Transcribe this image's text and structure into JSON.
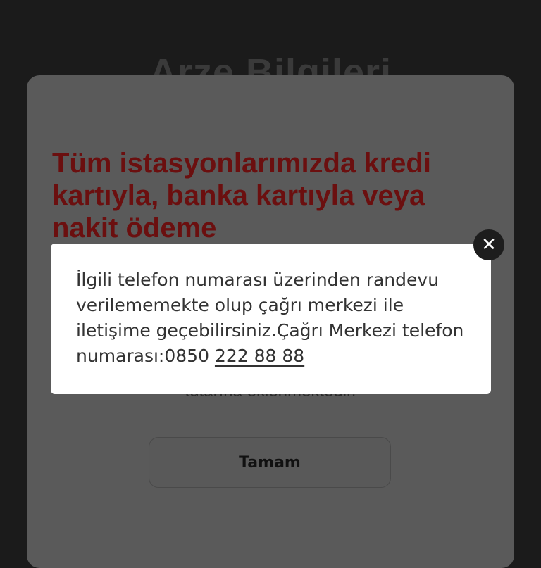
{
  "background": {
    "title": "Arze Bilgileri"
  },
  "modal": {
    "headline": "Tüm istasyonlarımızda kredi kartıyla, banka kartıyla veya nakit ödeme",
    "hidden_text": "tutarına eklenmektedir.",
    "ok_label": "Tamam"
  },
  "popup": {
    "text": "İlgili telefon numarası üzerinden randevu verilememekte olup çağrı merkezi ile iletişime geçebilirsiniz.Çağrı Merkezi telefon numarası:0850 ",
    "phone": "222 88 88",
    "close_glyph": "✕"
  }
}
